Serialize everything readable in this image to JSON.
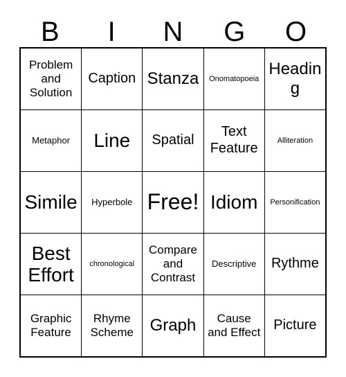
{
  "card": {
    "header_letters": [
      "B",
      "I",
      "N",
      "G",
      "O"
    ],
    "free_space_index": 12,
    "colors": {
      "border": "#000000",
      "cell_background": "#ffffff",
      "text": "#000000",
      "page_background": "#ffffff"
    },
    "cells": [
      {
        "text": "Problem and Solution",
        "size": "md"
      },
      {
        "text": "Caption",
        "size": "lg"
      },
      {
        "text": "Stanza",
        "size": "xl"
      },
      {
        "text": "Onomatopoeia",
        "size": "xs"
      },
      {
        "text": "Heading",
        "size": "xl"
      },
      {
        "text": "Metaphor",
        "size": "sm"
      },
      {
        "text": "Line",
        "size": "xxl"
      },
      {
        "text": "Spatial",
        "size": "lg"
      },
      {
        "text": "Text Feature",
        "size": "lg"
      },
      {
        "text": "Alliteration",
        "size": "xs"
      },
      {
        "text": "Simile",
        "size": "xxl"
      },
      {
        "text": "Hyperbole",
        "size": "sm"
      },
      {
        "text": "Free!",
        "size": "free"
      },
      {
        "text": "Idiom",
        "size": "xxl"
      },
      {
        "text": "Personification",
        "size": "xs"
      },
      {
        "text": "Best Effort",
        "size": "xxl"
      },
      {
        "text": "chronological",
        "size": "xs"
      },
      {
        "text": "Compare and Contrast",
        "size": "md"
      },
      {
        "text": "Descriptive",
        "size": "sm"
      },
      {
        "text": "Rythme",
        "size": "lg"
      },
      {
        "text": "Graphic Feature",
        "size": "md"
      },
      {
        "text": "Rhyme Scheme",
        "size": "md"
      },
      {
        "text": "Graph",
        "size": "xl"
      },
      {
        "text": "Cause and Effect",
        "size": "md"
      },
      {
        "text": "Picture",
        "size": "lg"
      }
    ]
  }
}
